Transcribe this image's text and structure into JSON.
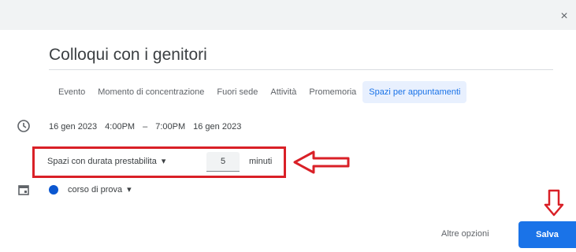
{
  "dialog": {
    "close_icon": "close-icon",
    "close_glyph": "×"
  },
  "event": {
    "title": "Colloqui con i genitori"
  },
  "tabs": [
    {
      "label": "Evento",
      "active": false
    },
    {
      "label": "Momento di concentrazione",
      "active": false
    },
    {
      "label": "Fuori sede",
      "active": false
    },
    {
      "label": "Attività",
      "active": false
    },
    {
      "label": "Promemoria",
      "active": false
    },
    {
      "label": "Spazi per appuntamenti",
      "active": true
    }
  ],
  "datetime": {
    "start_date": "16 gen 2023",
    "start_time": "4:00PM",
    "separator": "–",
    "end_time": "7:00PM",
    "end_date": "16 gen 2023"
  },
  "duration": {
    "type_label": "Spazi con durata prestabilita",
    "dropdown_glyph": "▾",
    "value": "5",
    "unit": "minuti"
  },
  "calendar": {
    "name": "corso di prova",
    "dropdown_glyph": "▾",
    "color": "#0b57d0"
  },
  "footer": {
    "more_options_label": "Altre opzioni",
    "save_label": "Salva"
  },
  "annotations": {
    "highlight_color": "#d92027"
  }
}
